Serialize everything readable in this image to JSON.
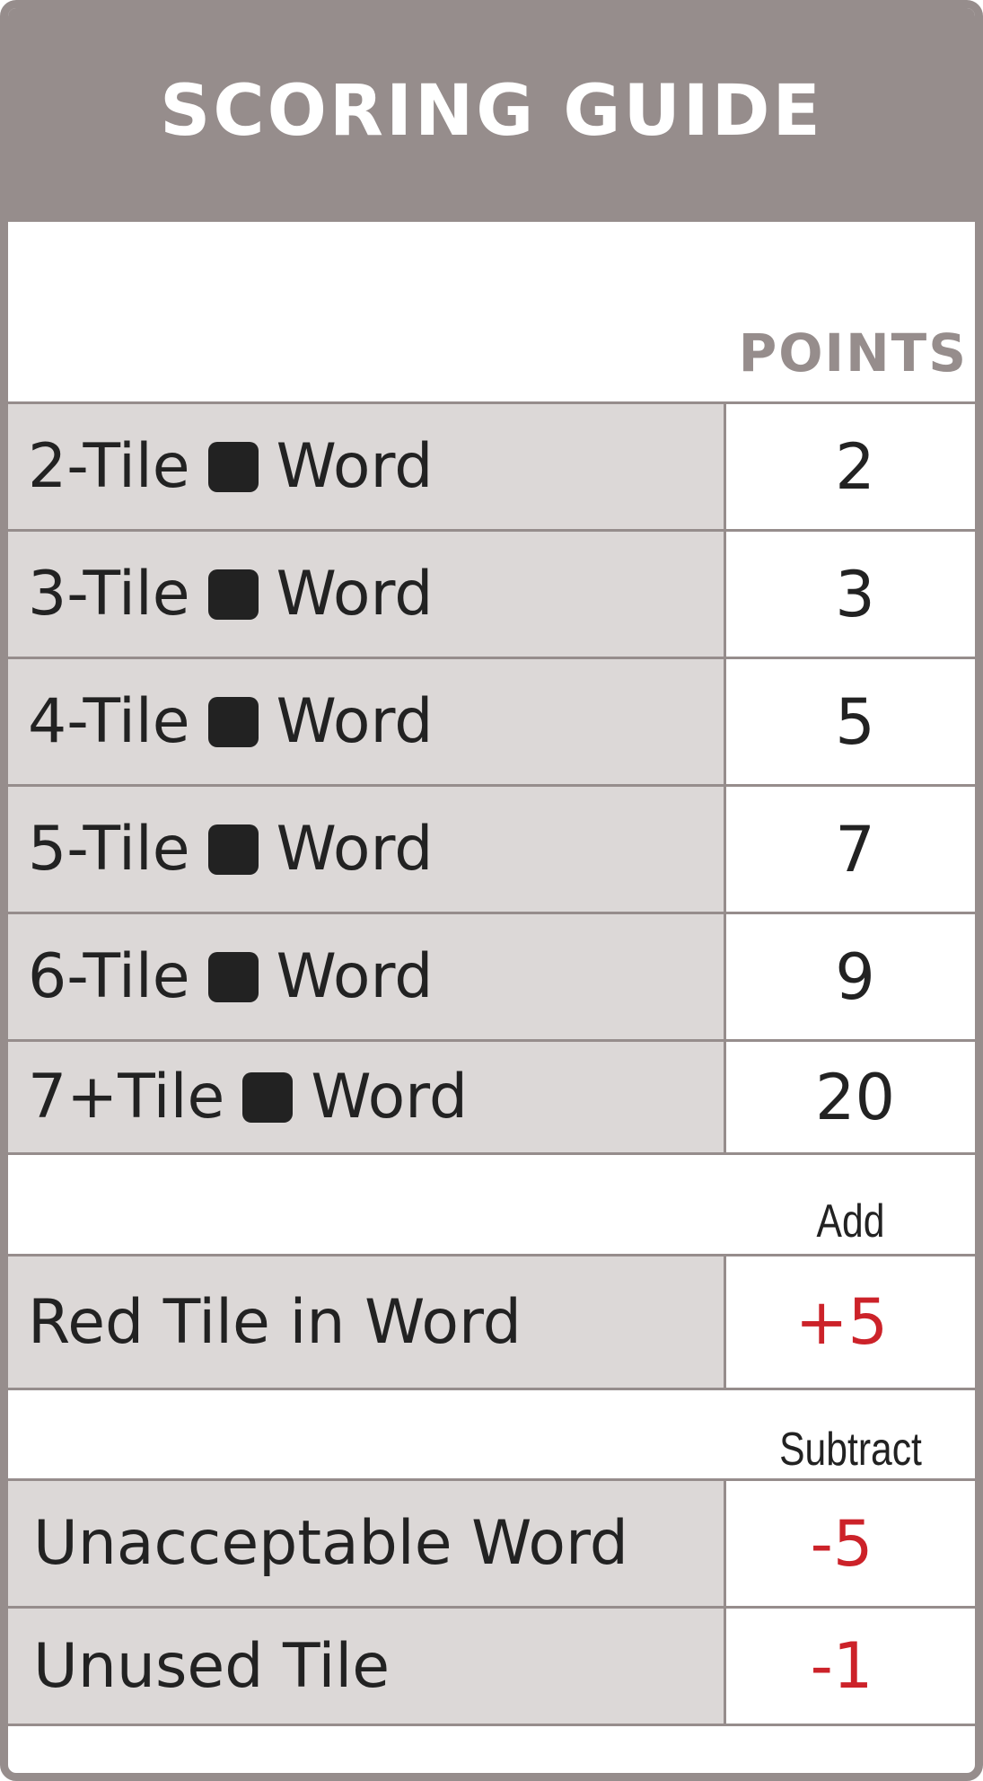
{
  "title": "SCORING GUIDE",
  "points_header": "POINTS",
  "word_rows": [
    {
      "prefix": "2-Tile",
      "suffix": "Word",
      "points": "2"
    },
    {
      "prefix": "3-Tile",
      "suffix": "Word",
      "points": "3"
    },
    {
      "prefix": "4-Tile",
      "suffix": "Word",
      "points": "5"
    },
    {
      "prefix": "5-Tile",
      "suffix": "Word",
      "points": "7"
    },
    {
      "prefix": "6-Tile",
      "suffix": "Word",
      "points": "9"
    },
    {
      "prefix": "7+Tile",
      "suffix": "Word",
      "points": "20"
    }
  ],
  "add_section": {
    "header": "Add",
    "rows": [
      {
        "label": "Red Tile in Word",
        "points": "+5"
      }
    ]
  },
  "subtract_section": {
    "header": "Subtract",
    "rows": [
      {
        "label": "Unacceptable Word",
        "points": "-5"
      },
      {
        "label": "Unused Tile",
        "points": "-1"
      }
    ]
  },
  "colors": {
    "frame": "#968d8c",
    "label_background": "#dcd8d7",
    "text": "#222222",
    "penalty_bonus": "#cc2229"
  },
  "icons": {
    "tile": "black-square-tile-icon"
  }
}
